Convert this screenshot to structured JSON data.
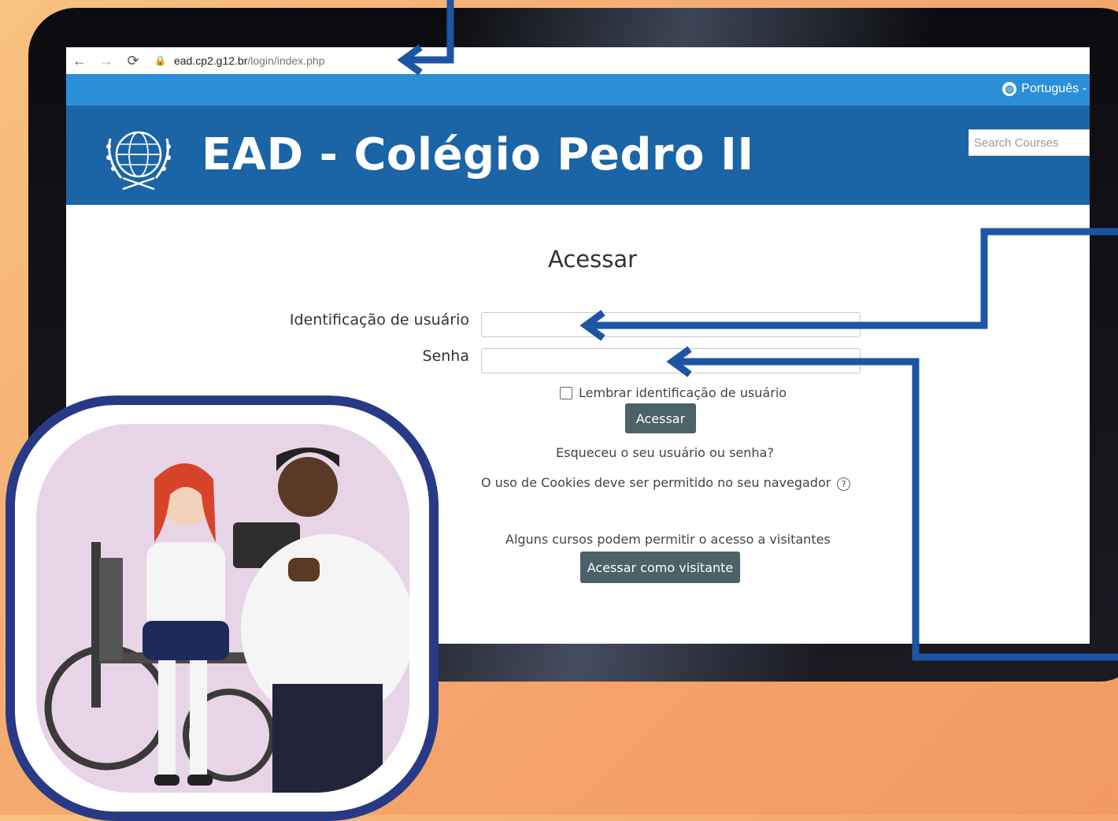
{
  "browser": {
    "url_host": "ead.cp2.g12.br",
    "url_path": "/login/index.php"
  },
  "topbar": {
    "language": "Português -"
  },
  "header": {
    "site_title": "EAD - Colégio Pedro II",
    "search_placeholder": "Search Courses"
  },
  "login": {
    "title": "Acessar",
    "username_label": "Identificação de usuário",
    "username_value": "",
    "password_label": "Senha",
    "password_value": "",
    "remember_label": "Lembrar identificação de usuário",
    "remember_checked": false,
    "submit_label": "Acessar",
    "forgot_link": "Esqueceu o seu usuário ou senha?",
    "cookies_notice": "O uso de Cookies deve ser permitido no seu navegador",
    "guest_notice": "Alguns cursos podem permitir o acesso a visitantes",
    "guest_button": "Acessar como visitante"
  },
  "colors": {
    "background": "#f4a86f",
    "topbar": "#2a8fd6",
    "header": "#1b64a5",
    "button": "#4a6268",
    "arrow": "#1d55a5",
    "badge_border": "#283a86",
    "badge_fill": "#e7d4e6"
  }
}
